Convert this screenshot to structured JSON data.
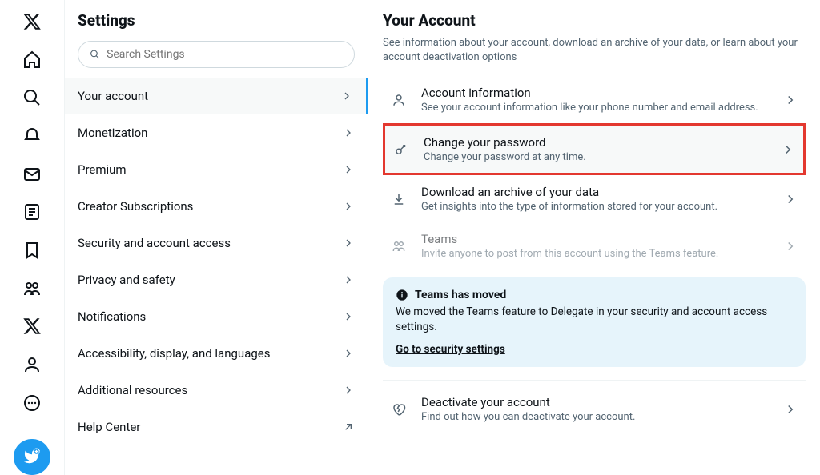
{
  "rail": {
    "icons": [
      "x-logo",
      "home",
      "search",
      "notifications",
      "messages",
      "lists",
      "bookmarks",
      "communities",
      "x-premium",
      "profile",
      "more"
    ],
    "compose": "compose"
  },
  "settings": {
    "title": "Settings",
    "search_placeholder": "Search Settings",
    "items": [
      {
        "label": "Your account",
        "active": true,
        "chev": "chevron-right"
      },
      {
        "label": "Monetization",
        "chev": "chevron-right"
      },
      {
        "label": "Premium",
        "chev": "chevron-right"
      },
      {
        "label": "Creator Subscriptions",
        "chev": "chevron-right"
      },
      {
        "label": "Security and account access",
        "chev": "chevron-right"
      },
      {
        "label": "Privacy and safety",
        "chev": "chevron-right"
      },
      {
        "label": "Notifications",
        "chev": "chevron-right"
      },
      {
        "label": "Accessibility, display, and languages",
        "chev": "chevron-right"
      },
      {
        "label": "Additional resources",
        "chev": "chevron-right"
      },
      {
        "label": "Help Center",
        "chev": "external-link"
      }
    ]
  },
  "main": {
    "title": "Your Account",
    "description": "See information about your account, download an archive of your data, or learn about your account deactivation options",
    "options": [
      {
        "icon": "person",
        "title": "Account information",
        "sub": "See your account information like your phone number and email address."
      },
      {
        "icon": "key",
        "title": "Change your password",
        "sub": "Change your password at any time.",
        "highlight": true
      },
      {
        "icon": "download",
        "title": "Download an archive of your data",
        "sub": "Get insights into the type of information stored for your account."
      },
      {
        "icon": "people",
        "title": "Teams",
        "sub": "Invite anyone to post from this account using the Teams feature.",
        "disabled": true
      }
    ],
    "notice": {
      "title": "Teams has moved",
      "body": "We moved the Teams feature to Delegate in your security and account access settings.",
      "link": "Go to security settings"
    },
    "deactivate": {
      "icon": "heart-broken",
      "title": "Deactivate your account",
      "sub": "Find out how you can deactivate your account."
    }
  }
}
